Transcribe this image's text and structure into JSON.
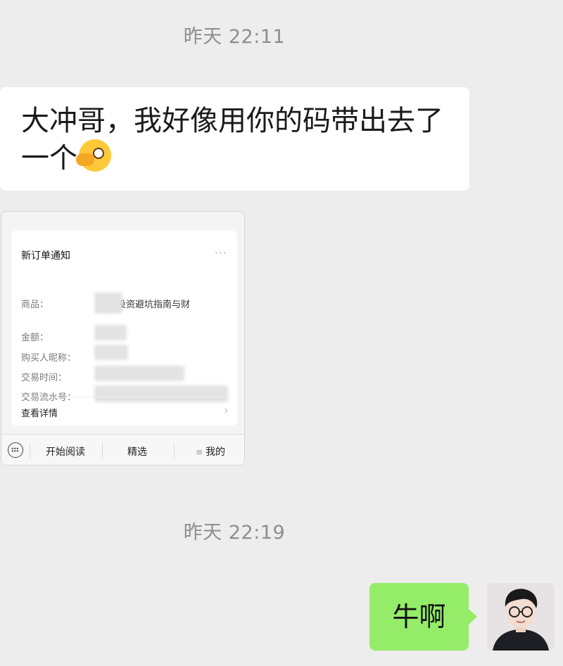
{
  "messages": [
    {
      "type": "timestamp",
      "text": "昨天 22:11"
    },
    {
      "type": "incoming_text",
      "text": "大冲哥，我好像用你的码带出去了一个",
      "emoji": "face-with-peeking-eye"
    },
    {
      "type": "incoming_card",
      "notice": {
        "title": "新订单通知",
        "more_icon": "···",
        "fields": [
          {
            "label": "商品：",
            "value": "投资避坑指南与财"
          },
          {
            "label": "金额：",
            "value": ""
          },
          {
            "label": "购买人昵称：",
            "value": ""
          },
          {
            "label": "交易时间：",
            "value": ""
          },
          {
            "label": "交易流水号：",
            "value": ""
          }
        ],
        "details_link": "查看详情",
        "chevron": "›"
      },
      "menu": {
        "keyboard_icon": "keyboard-icon",
        "items": [
          "开始阅读",
          "精选",
          "我的"
        ]
      }
    },
    {
      "type": "timestamp",
      "text": "昨天 22:19"
    },
    {
      "type": "outgoing_text",
      "text": "牛啊"
    }
  ],
  "colors": {
    "chat_background": "#ededed",
    "incoming_bubble": "#ffffff",
    "outgoing_bubble": "#95ec69",
    "timestamp_text": "#8e8e8e"
  }
}
